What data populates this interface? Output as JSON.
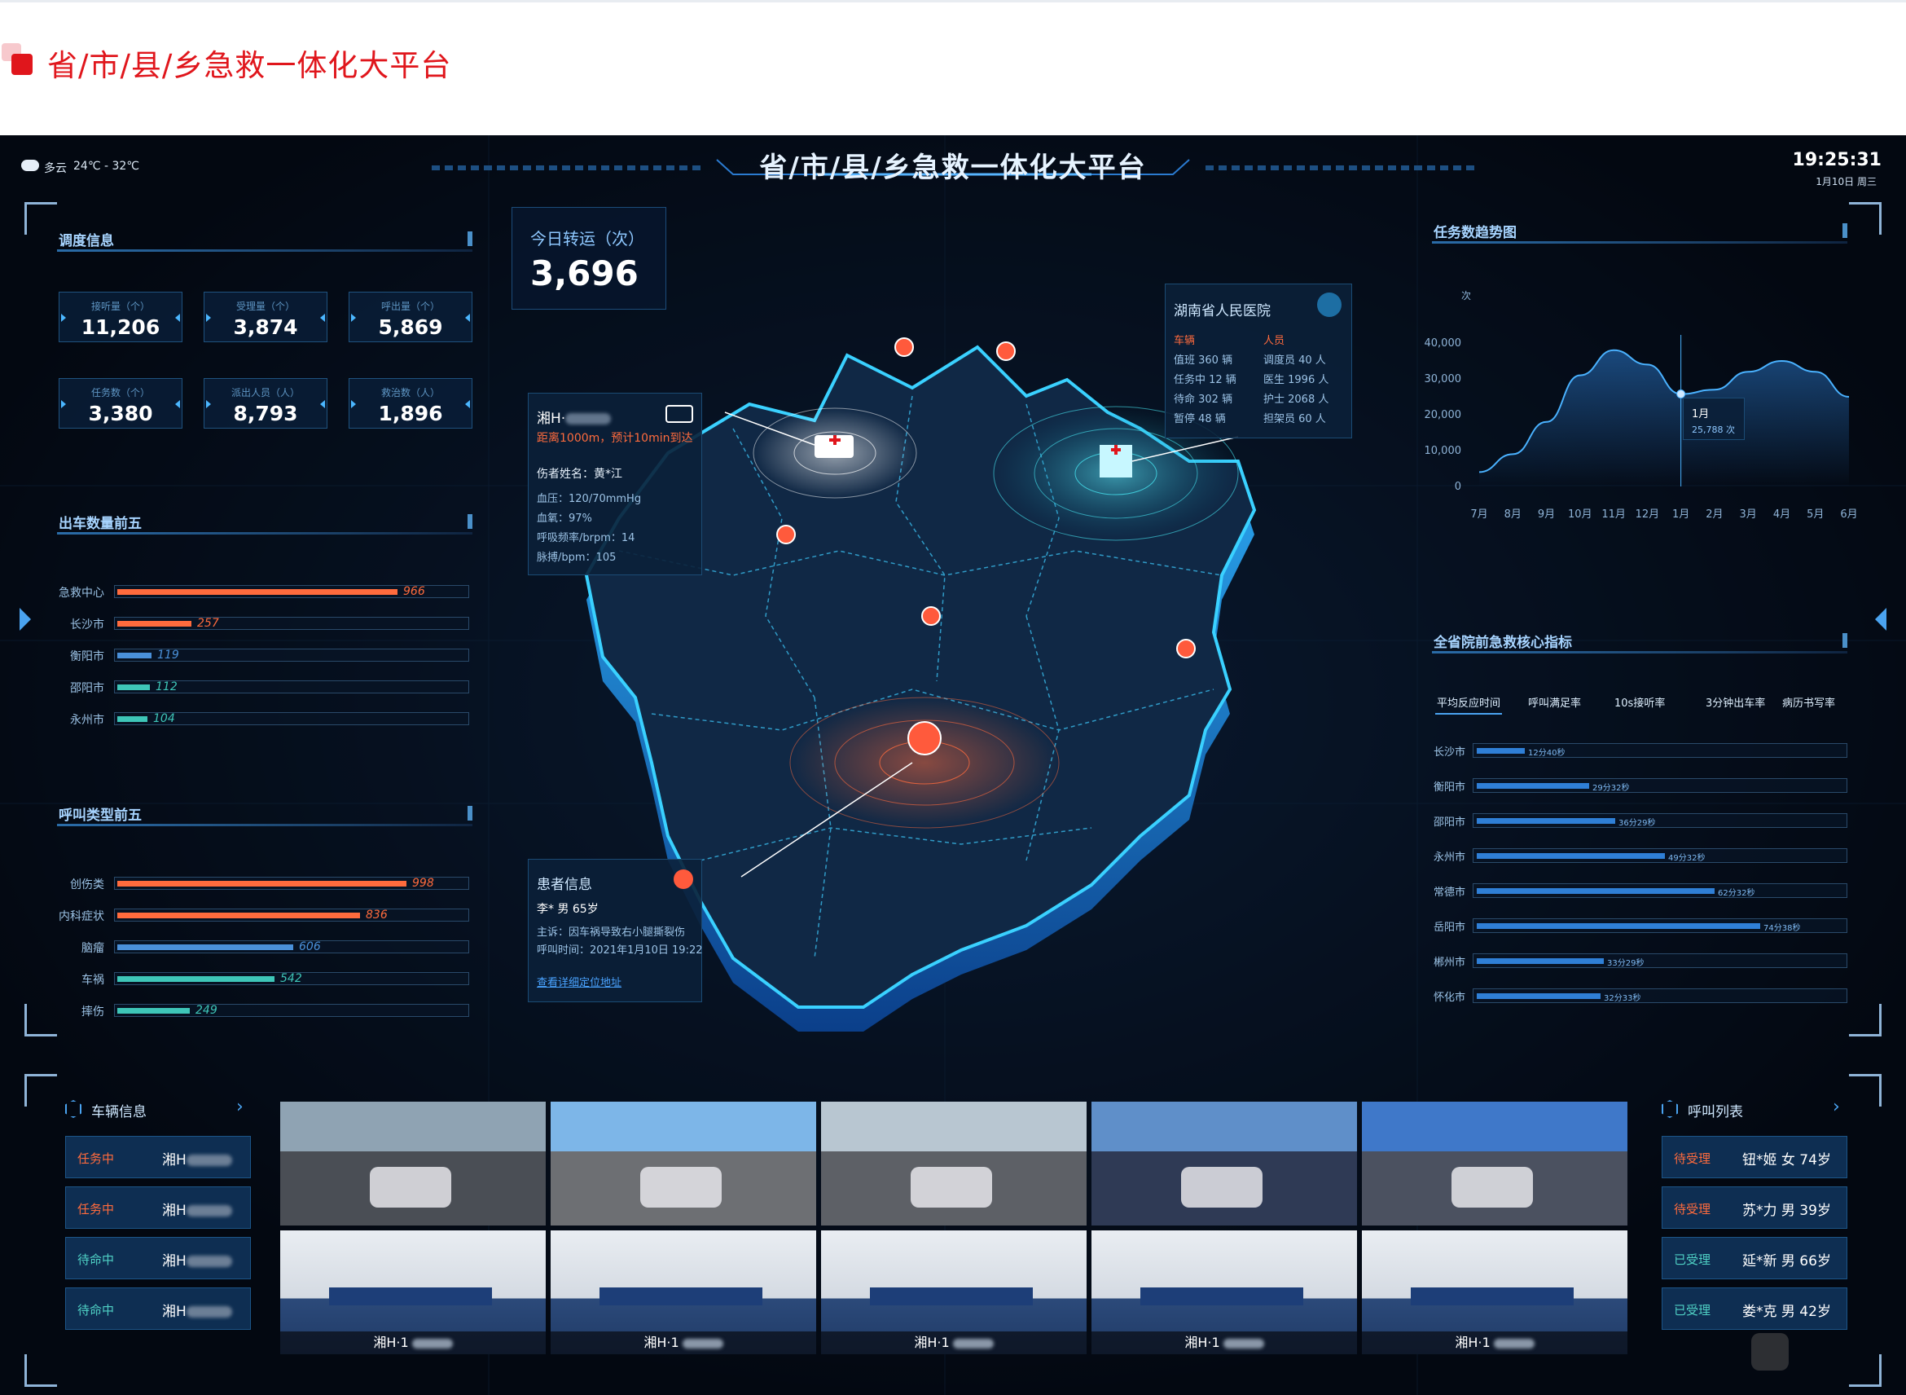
{
  "page_title": "省/市/县/乡急救一体化大平台",
  "dashboard": {
    "title": "省/市/县/乡急救一体化大平台",
    "weather": {
      "condition": "多云",
      "temp": "24℃ - 32℃"
    },
    "clock": {
      "time": "19:25:31",
      "date": "1月10日 周三"
    },
    "dispatch": {
      "title": "调度信息",
      "stats": [
        {
          "label": "接听量（个）",
          "value": "11,206"
        },
        {
          "label": "受理量（个）",
          "value": "3,874"
        },
        {
          "label": "呼出量（个）",
          "value": "5,869"
        },
        {
          "label": "任务数（个）",
          "value": "3,380"
        },
        {
          "label": "派出人员（人）",
          "value": "8,793"
        },
        {
          "label": "救治数（人）",
          "value": "1,896"
        }
      ]
    },
    "top_dispatch": {
      "title": "出车数量前五",
      "max": 1000,
      "items": [
        {
          "label": "急救中心",
          "value": 966
        },
        {
          "label": "长沙市",
          "value": 257
        },
        {
          "label": "衡阳市",
          "value": 119
        },
        {
          "label": "邵阳市",
          "value": 112
        },
        {
          "label": "永州市",
          "value": 104
        }
      ]
    },
    "top_calls": {
      "title": "呼叫类型前五",
      "max": 1000,
      "items": [
        {
          "label": "创伤类",
          "value": 998
        },
        {
          "label": "内科症状",
          "value": 836
        },
        {
          "label": "脑瘤",
          "value": 606
        },
        {
          "label": "车祸",
          "value": 542
        },
        {
          "label": "摔伤",
          "value": 249
        }
      ]
    },
    "today_transfer": {
      "label": "今日转运（次）",
      "value": "3,696"
    },
    "ambulance_card": {
      "plate": "湘H·",
      "distance": "距离1000m，预计10min到达",
      "patient_name": "伤者姓名：黄*江",
      "bp": "血压：120/70mmHg",
      "spo2": "血氧：97%",
      "resp": "呼吸频率/brpm：14",
      "pulse": "脉搏/bpm：105"
    },
    "hospital_card": {
      "name": "湖南省人民医院",
      "vehicles_header": "车辆",
      "staff_header": "人员",
      "vehicles": [
        "值班 360 辆",
        "任务中 12 辆",
        "待命 302 辆",
        "暂停 48 辆"
      ],
      "staff": [
        "调度员 40 人",
        "医生 1996 人",
        "护士 2068 人",
        "担架员 60 人"
      ]
    },
    "patient_card": {
      "title": "患者信息",
      "person": "李* 男 65岁",
      "complaint": "主诉：因车祸导致右小腿撕裂伤",
      "call_time": "呼叫时间：2021年1月10日 19:22",
      "link": "查看详细定位地址"
    },
    "trend": {
      "title": "任务数趋势图",
      "unit": "次",
      "tooltip_month": "1月",
      "tooltip_value": "25,788 次"
    },
    "kpi": {
      "title": "全省院前急救核心指标",
      "tabs": [
        "平均反应时间",
        "呼叫满足率",
        "10s接听率",
        "3分钟出车率",
        "病历书写率"
      ],
      "active_tab": 0,
      "max": 90,
      "rows": [
        {
          "city": "长沙市",
          "value": "12分40秒",
          "minutes": 12.67
        },
        {
          "city": "衡阳市",
          "value": "29分32秒",
          "minutes": 29.53
        },
        {
          "city": "邵阳市",
          "value": "36分29秒",
          "minutes": 36.48
        },
        {
          "city": "永州市",
          "value": "49分32秒",
          "minutes": 49.53
        },
        {
          "city": "常德市",
          "value": "62分32秒",
          "minutes": 62.53
        },
        {
          "city": "岳阳市",
          "value": "74分38秒",
          "minutes": 74.63
        },
        {
          "city": "郴州市",
          "value": "33分29秒",
          "minutes": 33.48
        },
        {
          "city": "怀化市",
          "value": "32分33秒",
          "minutes": 32.55
        }
      ],
      "more": "……"
    },
    "vehicles": {
      "title": "车辆信息",
      "rows": [
        {
          "status": "任务中",
          "plate": "湘H",
          "color": "#ff6b3d"
        },
        {
          "status": "任务中",
          "plate": "湘H",
          "color": "#ff6b3d"
        },
        {
          "status": "待命中",
          "plate": "湘H",
          "color": "#4fd1c5"
        },
        {
          "status": "待命中",
          "plate": "湘H",
          "color": "#4fd1c5"
        }
      ]
    },
    "video_labels": [
      "湘H·1",
      "湘H·1",
      "湘H·1",
      "湘H·1",
      "湘H·1"
    ],
    "calls": {
      "title": "呼叫列表",
      "rows": [
        {
          "status": "待受理",
          "person": "钮*姬 女 74岁",
          "color": "#ff6b3d"
        },
        {
          "status": "待受理",
          "person": "苏*力 男 39岁",
          "color": "#ff6b3d"
        },
        {
          "status": "已受理",
          "person": "延*新 男 66岁",
          "color": "#4fd1c5"
        },
        {
          "status": "已受理",
          "person": "娄*克 男 42岁",
          "color": "#4fd1c5"
        }
      ]
    }
  },
  "chart_data": {
    "type": "area",
    "title": "任务数趋势图",
    "ylabel": "次",
    "categories": [
      "7月",
      "8月",
      "9月",
      "10月",
      "11月",
      "12月",
      "1月",
      "2月",
      "3月",
      "4月",
      "5月",
      "6月"
    ],
    "series": [
      {
        "values": [
          4000,
          9000,
          18000,
          31000,
          38000,
          34000,
          25788,
          27000,
          32000,
          35000,
          32000,
          25000
        ]
      }
    ],
    "yticks": [
      0,
      10000,
      20000,
      30000,
      40000
    ],
    "ylim": [
      0,
      40000
    ],
    "grid": false
  }
}
